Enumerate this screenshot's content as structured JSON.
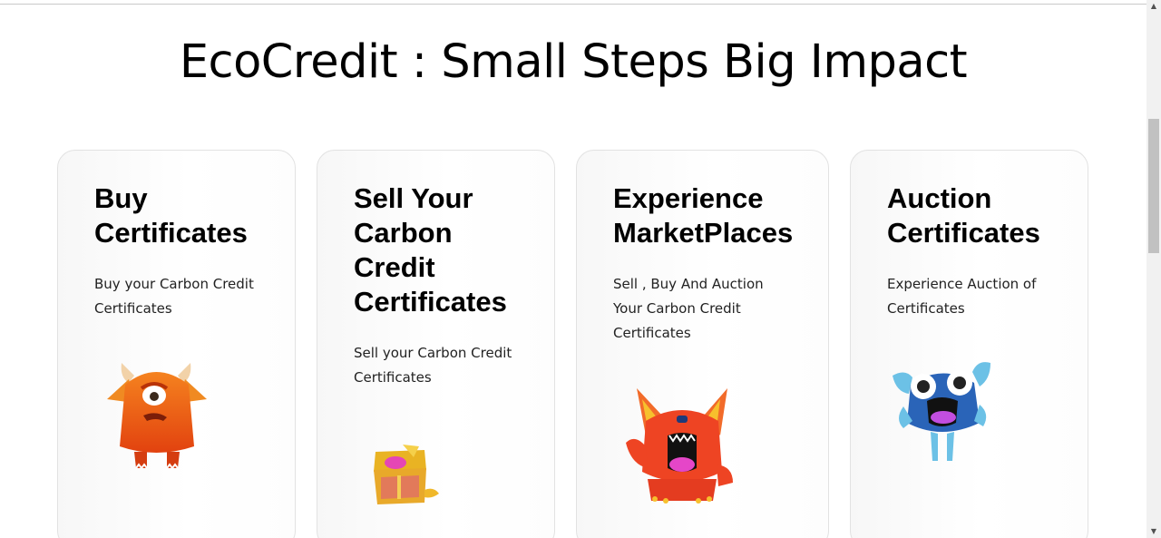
{
  "page": {
    "title": "EcoCredit : Small Steps Big Impact"
  },
  "cards": [
    {
      "title_lines": [
        "Buy",
        "Certificates"
      ],
      "description": "Buy your Carbon Credit Certificates",
      "icon": "orange-monster-icon"
    },
    {
      "title_lines": [
        "Sell Your",
        "Carbon",
        "Credit",
        "Certificates"
      ],
      "description": "Sell your Carbon Credit Certificates",
      "icon": "treasure-chest-icon"
    },
    {
      "title_lines": [
        "Experience",
        "MarketPlaces"
      ],
      "description": "Sell , Buy And Auction Your Carbon Credit Certificates",
      "icon": "red-fox-monster-icon"
    },
    {
      "title_lines": [
        "Auction",
        "Certificates"
      ],
      "description": "Experience Auction of Certificates",
      "icon": "blue-monster-icon"
    }
  ],
  "scrollbar": {
    "up_arrow": "▲",
    "down_arrow": "▼"
  },
  "colors": {
    "orange": "#f26a1b",
    "red": "#ee4423",
    "blue": "#2a64b8",
    "gold": "#e9b323"
  }
}
